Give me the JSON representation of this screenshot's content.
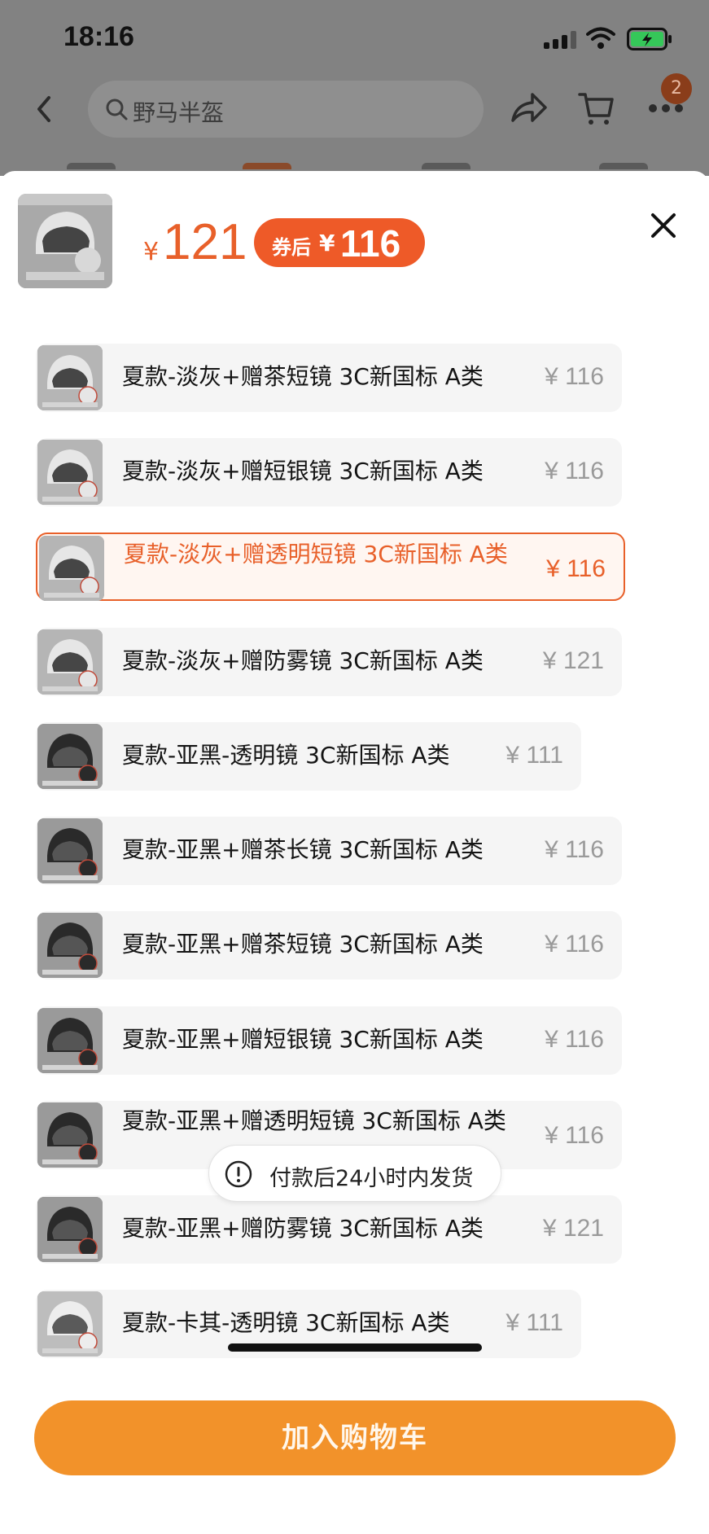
{
  "status_bar": {
    "time": "18:16"
  },
  "navbar": {
    "search_placeholder": "野马半盔",
    "cart_badge": "2"
  },
  "product": {
    "currency": "¥",
    "price": "121",
    "coupon_label": "券后",
    "coupon_currency": "¥",
    "coupon_price": "116"
  },
  "options": [
    {
      "name": "夏款-淡灰+赠茶短镜 3C新国标 A类",
      "price": "¥ 116",
      "variant": "light"
    },
    {
      "name": "夏款-淡灰+赠短银镜 3C新国标 A类",
      "price": "¥ 116",
      "variant": "light"
    },
    {
      "name": "夏款-淡灰+赠透明短镜 3C新国标 A类",
      "price": "¥ 116",
      "variant": "light",
      "selected": true
    },
    {
      "name": "夏款-淡灰+赠防雾镜 3C新国标 A类",
      "price": "¥ 121",
      "variant": "light"
    },
    {
      "name": "夏款-亚黑-透明镜 3C新国标 A类",
      "price": "¥ 111",
      "variant": "dark"
    },
    {
      "name": "夏款-亚黑+赠茶长镜 3C新国标 A类",
      "price": "¥ 116",
      "variant": "dark"
    },
    {
      "name": "夏款-亚黑+赠茶短镜 3C新国标 A类",
      "price": "¥ 116",
      "variant": "dark"
    },
    {
      "name": "夏款-亚黑+赠短银镜 3C新国标 A类",
      "price": "¥ 116",
      "variant": "dark"
    },
    {
      "name": "夏款-亚黑+赠透明短镜 3C新国标 A类",
      "price": "¥ 116",
      "variant": "dark"
    },
    {
      "name": "夏款-亚黑+赠防雾镜 3C新国标 A类",
      "price": "¥ 121",
      "variant": "dark"
    },
    {
      "name": "夏款-卡其-透明镜 3C新国标 A类",
      "price": "¥ 111",
      "variant": "khaki"
    }
  ],
  "toast": {
    "text": "付款后24小时内发货"
  },
  "add_to_cart_label": "加入购物车",
  "colors": {
    "accent": "#e8602a",
    "button": "#f2922a",
    "coupon": "#ee5a28"
  }
}
